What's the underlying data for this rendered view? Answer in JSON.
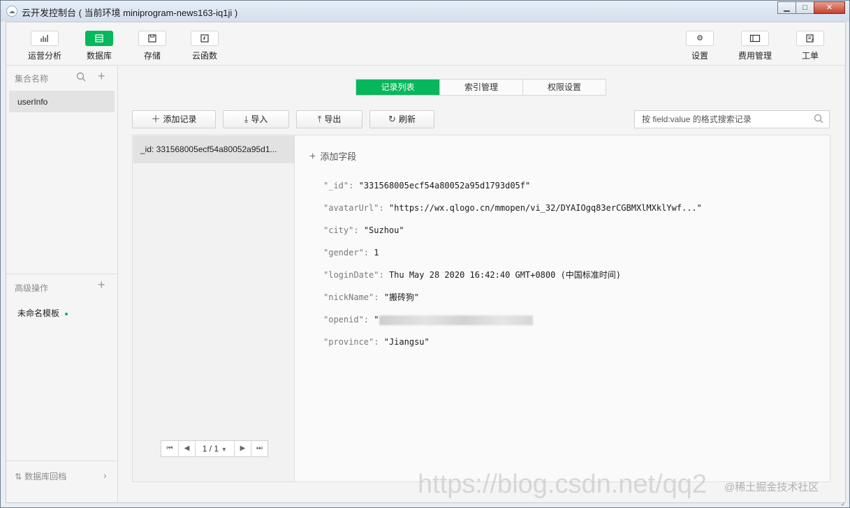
{
  "window": {
    "title": "云开发控制台 ( 当前环境 miniprogram-news163-iq1ji )",
    "app_icon": "cloud-icon",
    "controls": [
      "minimize-icon",
      "maximize-icon",
      "close-icon"
    ]
  },
  "toolbar": {
    "left": [
      {
        "label": "运营分析",
        "icon": "bar-chart-icon",
        "active": false
      },
      {
        "label": "数据库",
        "icon": "database-icon",
        "active": true
      },
      {
        "label": "存储",
        "icon": "save-icon",
        "active": false
      },
      {
        "label": "云函数",
        "icon": "function-icon",
        "active": false
      }
    ],
    "right": [
      {
        "label": "设置",
        "icon": "gear-icon"
      },
      {
        "label": "费用管理",
        "icon": "wallet-icon"
      },
      {
        "label": "工单",
        "icon": "ticket-icon"
      }
    ]
  },
  "sidebar": {
    "collection_header": "集合名称",
    "collections": [
      "userInfo"
    ],
    "advanced_header": "高级操作",
    "templates": [
      "未命名模板"
    ],
    "backup_label": "数据库回档"
  },
  "main": {
    "tabs": [
      {
        "label": "记录列表",
        "active": true
      },
      {
        "label": "索引管理",
        "active": false
      },
      {
        "label": "权限设置",
        "active": false
      }
    ],
    "actions": {
      "add": "添加记录",
      "import": "导入",
      "export": "导出",
      "refresh": "刷新"
    },
    "search": {
      "placeholder": "按 field:value 的格式搜索记录",
      "value": ""
    },
    "records": [
      "_id: 331568005ecf54a80052a95d1..."
    ],
    "pager": {
      "text": "1 / 1"
    },
    "add_field_label": "添加字段",
    "fields": [
      {
        "key": "\"_id\":",
        "value": "\"331568005ecf54a80052a95d1793d05f\""
      },
      {
        "key": "\"avatarUrl\":",
        "value": "\"https://wx.qlogo.cn/mmopen/vi_32/DYAIOgq83erCGBMXlMXklYwf...\""
      },
      {
        "key": "\"city\":",
        "value": "\"Suzhou\""
      },
      {
        "key": "\"gender\":",
        "value": "1"
      },
      {
        "key": "\"loginDate\":",
        "value": "Thu May 28 2020 16:42:40 GMT+0800 (中国标准时间)"
      },
      {
        "key": "\"nickName\":",
        "value": "\"搬砖狗\""
      },
      {
        "key": "\"openid\":",
        "value": "\""
      },
      {
        "key": "\"province\":",
        "value": "\"Jiangsu\""
      }
    ]
  },
  "watermark": {
    "url": "https://blog.csdn.net/qq2",
    "brand": "@稀土掘金技术社区"
  },
  "colors": {
    "accent": "#07b75c"
  }
}
